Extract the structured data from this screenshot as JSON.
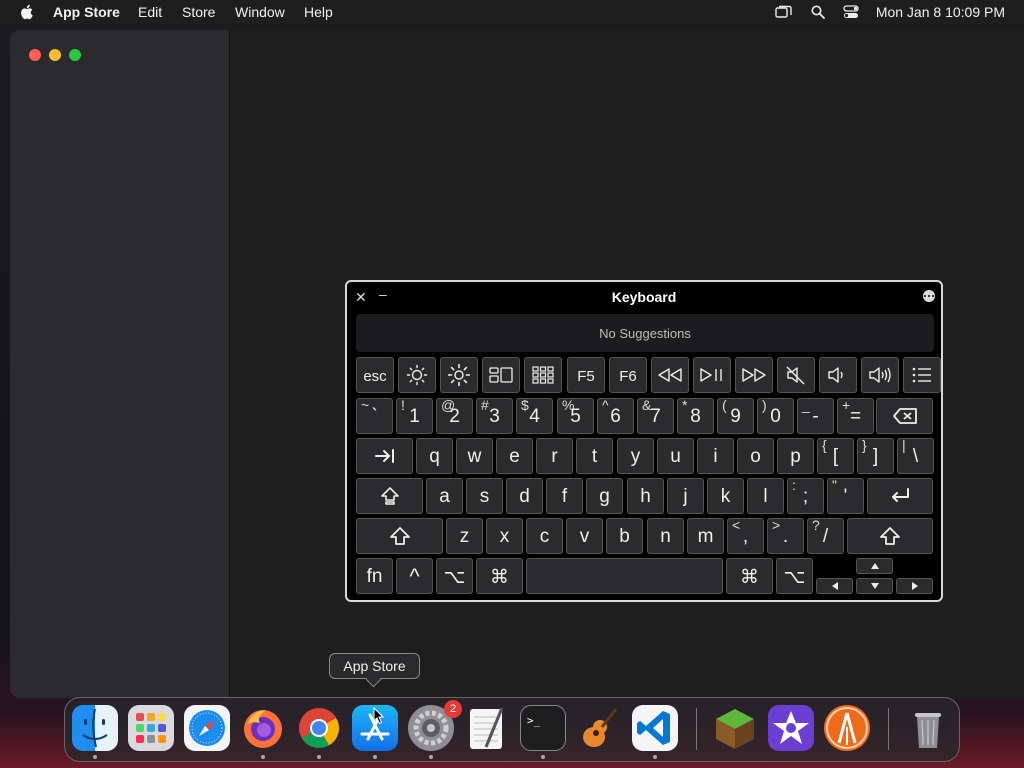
{
  "menubar": {
    "app_name": "App Store",
    "menus": [
      "Edit",
      "Store",
      "Window",
      "Help"
    ],
    "clock": "Mon Jan 8  10:09 PM"
  },
  "keyboard_viewer": {
    "title": "Keyboard",
    "suggestions_text": "No Suggestions",
    "function_row": [
      "esc",
      "brightness-down-icon",
      "brightness-up-icon",
      "mission-control-icon",
      "launchpad-icon",
      "F5",
      "F6",
      "rewind-icon",
      "play-pause-icon",
      "fast-forward-icon",
      "mute-icon",
      "volume-down-icon",
      "volume-up-icon",
      "list-icon"
    ],
    "number_row": [
      {
        "alt": "~",
        "main": "`"
      },
      {
        "alt": "!",
        "main": "1"
      },
      {
        "alt": "@",
        "main": "2"
      },
      {
        "alt": "#",
        "main": "3"
      },
      {
        "alt": "$",
        "main": "4"
      },
      {
        "alt": "%",
        "main": "5"
      },
      {
        "alt": "^",
        "main": "6"
      },
      {
        "alt": "&",
        "main": "7"
      },
      {
        "alt": "*",
        "main": "8"
      },
      {
        "alt": "(",
        "main": "9"
      },
      {
        "alt": ")",
        "main": "0"
      },
      {
        "alt": "_",
        "main": "-"
      },
      {
        "alt": "+",
        "main": "="
      }
    ],
    "row_q": [
      "q",
      "w",
      "e",
      "r",
      "t",
      "y",
      "u",
      "i",
      "o",
      "p"
    ],
    "row_q_sym": [
      {
        "alt": "{",
        "main": "["
      },
      {
        "alt": "}",
        "main": "]"
      },
      {
        "alt": "|",
        "main": "\\"
      }
    ],
    "row_a": [
      "a",
      "s",
      "d",
      "f",
      "g",
      "h",
      "j",
      "k",
      "l"
    ],
    "row_a_sym": [
      {
        "alt": ":",
        "main": ";"
      },
      {
        "alt": "\"",
        "main": "'"
      }
    ],
    "row_z": [
      "z",
      "x",
      "c",
      "v",
      "b",
      "n",
      "m"
    ],
    "row_z_sym": [
      {
        "alt": "<",
        "main": ","
      },
      {
        "alt": ">",
        "main": "."
      },
      {
        "alt": "?",
        "main": "/"
      }
    ],
    "bottom": {
      "fn": "fn",
      "control": "^",
      "option": "⌥",
      "command": "⌘"
    }
  },
  "tooltip": "App Store",
  "dock": {
    "apps": [
      "Finder",
      "Launchpad",
      "Safari",
      "Firefox",
      "Chrome",
      "App Store",
      "System Settings",
      "TextEdit",
      "Terminal",
      "GarageBand",
      "VS Code",
      "Minecraft",
      "iMovie",
      "Instruments",
      "Trash"
    ],
    "settings_badge": "2"
  },
  "colors": {
    "close": "#ff5f57",
    "minimize": "#febc2e",
    "zoom": "#28c840",
    "badge": "#e53935"
  }
}
